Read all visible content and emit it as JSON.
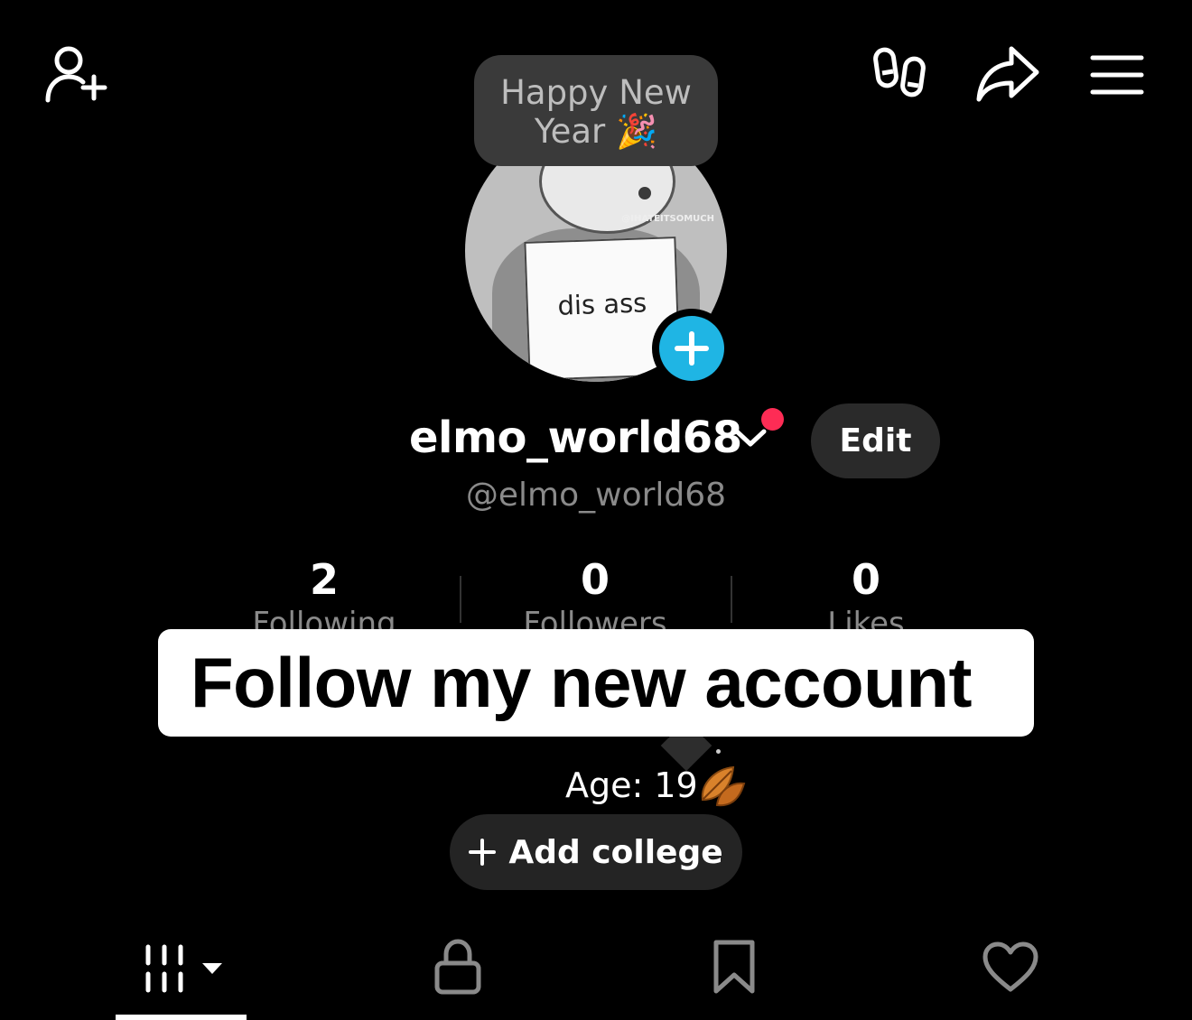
{
  "note": {
    "line1": "Happy New",
    "line2": "Year",
    "emoji": "🎉"
  },
  "avatar": {
    "card_text": "dis ass",
    "watermark": "@IHATEITSOMUCH"
  },
  "profile": {
    "display_name": "elmo_world68",
    "handle": "@elmo_world68",
    "edit_label": "Edit"
  },
  "stats": [
    {
      "value": "2",
      "label": "Following"
    },
    {
      "value": "0",
      "label": "Followers"
    },
    {
      "value": "0",
      "label": "Likes"
    }
  ],
  "caption": {
    "text": "Follow my new account"
  },
  "bio": {
    "text": "Age: 19",
    "emoji": "🍂"
  },
  "add_college": {
    "label": "Add college"
  },
  "icons": {
    "top_left": "add-friend-icon",
    "top_right": [
      "footprints-icon",
      "share-icon",
      "menu-icon"
    ],
    "tabs": [
      "videos-grid-icon",
      "lock-icon",
      "bookmark-icon",
      "heart-icon"
    ]
  },
  "colors": {
    "background": "#000000",
    "accent_blue": "#1fb5e4",
    "notification_red": "#fe2c55",
    "pill_bg": "#242424"
  }
}
